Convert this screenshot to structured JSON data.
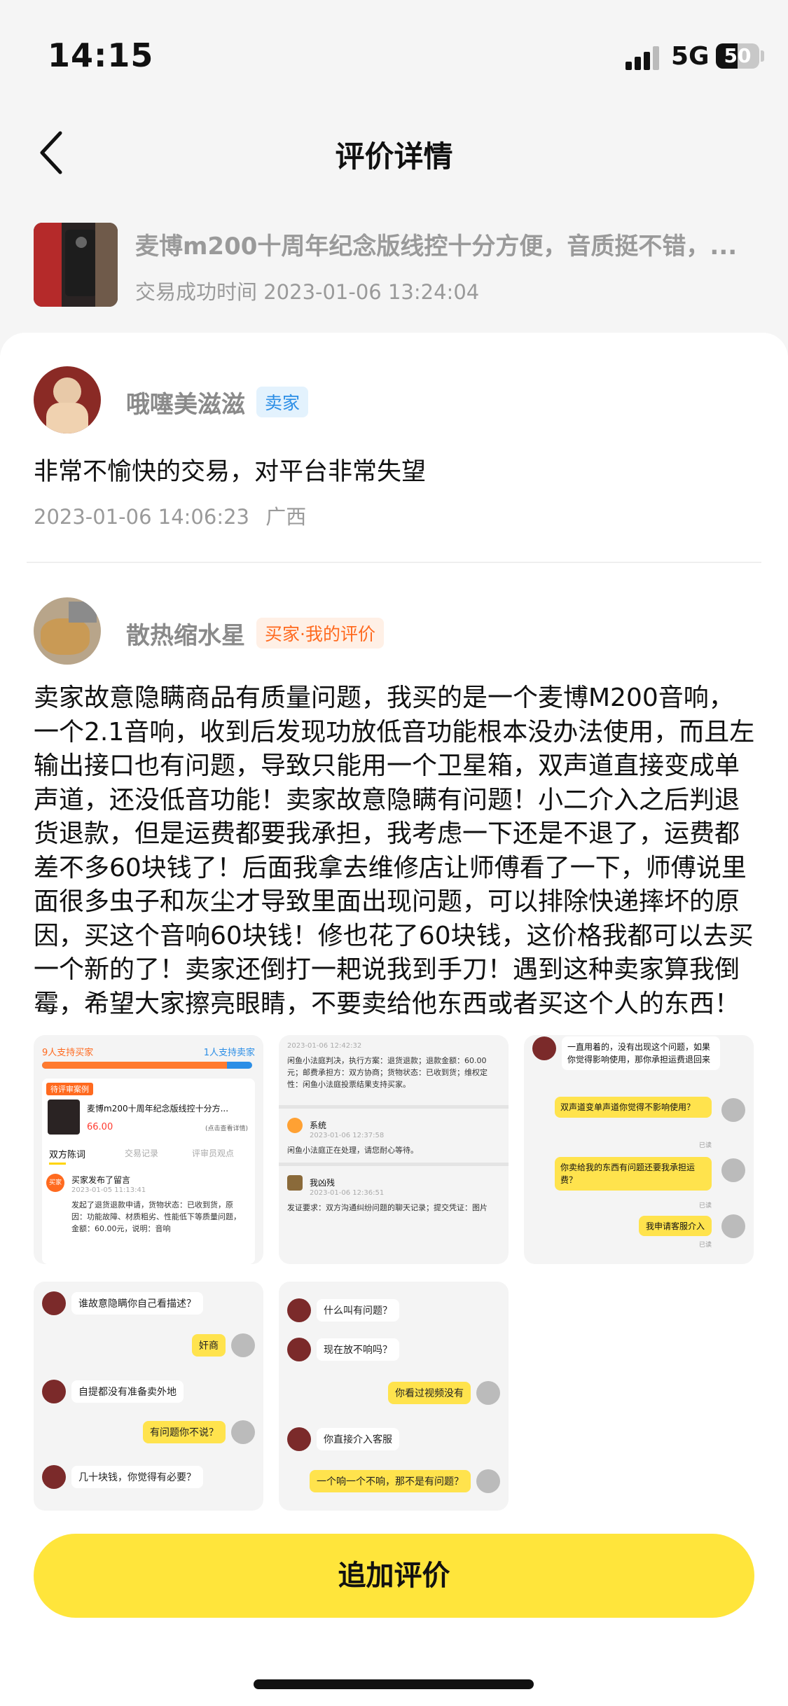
{
  "status": {
    "time": "14:15",
    "network": "5G",
    "battery": "50",
    "battery_level": 0.5
  },
  "header": {
    "title": "评价详情"
  },
  "product": {
    "title": "麦博m200十周年纪念版线控十分方便，音质挺不错，...",
    "trade_time": "交易成功时间 2023-01-06 13:24:04"
  },
  "seller_review": {
    "user": "哦噻美滋滋",
    "role_badge": "卖家",
    "text": "非常不愉快的交易，对平台非常失望",
    "date": "2023-01-06 14:06:23",
    "location": "广西"
  },
  "buyer_review": {
    "user": "散热缩水星",
    "role_badge": "买家·我的评价",
    "text": "卖家故意隐瞒商品有质量问题，我买的是一个麦博M200音响，一个2.1音响，收到后发现功放低音功能根本没办法使用，而且左输出接口也有问题，导致只能用一个卫星箱，双声道直接变成单声道，还没低音功能！卖家故意隐瞒有问题！小二介入之后判退货退款，但是运费都要我承担，我考虑一下还是不退了，运费都差不多60块钱了！后面我拿去维修店让师傅看了一下，师傅说里面很多虫子和灰尘才导致里面出现问题，可以排除快递摔坏的原因，买这个音响60块钱！修也花了60块钱，这价格我都可以去买一个新的了！卖家还倒打一耙说我到手刀！遇到这种卖家算我倒霉，希望大家擦亮眼睛，不要卖给他东西或者买这个人的东西！"
  },
  "shot1": {
    "support_buyer": "9人支持买家",
    "support_seller": "1人支持卖家",
    "pending_tag": "待评审案例",
    "item_title": "麦博m200十周年纪念版线控十分方...",
    "price": "66.00",
    "view_detail": "(点击查看详情)",
    "tabs": [
      "双方陈词",
      "交易记录",
      "评审员观点"
    ],
    "buyer_tag": "买家",
    "msg_title": "买家发布了留言",
    "msg_time": "2023-01-05 11:13:41",
    "msg_body": "发起了退货退款申请，货物状态：已收到货，原因：功能故障、材质粗劣、性能低下等质量问题，金额：60.00元，说明：音响"
  },
  "shot2": {
    "time1": "2023-01-06 12:42:32",
    "body1": "闲鱼小法庭判决，执行方案：退货退款；退款金额：60.00元；邮费承担方：双方协商；货物状态：已收到货；维权定性：闲鱼小法庭投票结果支持买家。",
    "sys": "系统",
    "time2": "2023-01-06 12:37:58",
    "body2": "闲鱼小法庭正在处理，请您耐心等待。",
    "me": "我凶残",
    "time3": "2023-01-06 12:36:51",
    "body3": "发证要求：双方沟通纠纷问题的聊天记录；提交凭证：图片"
  },
  "shot3": {
    "m1": "一直用着的，没有出现这个问题，如果你觉得影响使用，那你承担运费退回来",
    "m2": "双声道变单声道你觉得不影响使用？",
    "m3": "你卖给我的东西有问题还要我承担运费？",
    "m4": "我申请客服介入",
    "read": "已读"
  },
  "shot4": {
    "m1": "谁故意隐瞒你自己看描述？",
    "m2": "奸商",
    "m3": "自提都没有准备卖外地",
    "m4": "有问题你不说？",
    "m5": "几十块钱，你觉得有必要？"
  },
  "shot5": {
    "m1": "什么叫有问题？",
    "m2": "现在放不响吗？",
    "m3": "你看过视频没有",
    "m4": "你直接介入客服",
    "m5": "一个响一个不响，那不是有问题？"
  },
  "action": {
    "add_review": "追加评价"
  },
  "colors": {
    "accent": "#ffe53b",
    "seller_badge": "#2b8ee6",
    "buyer_badge": "#ff6a1f"
  }
}
